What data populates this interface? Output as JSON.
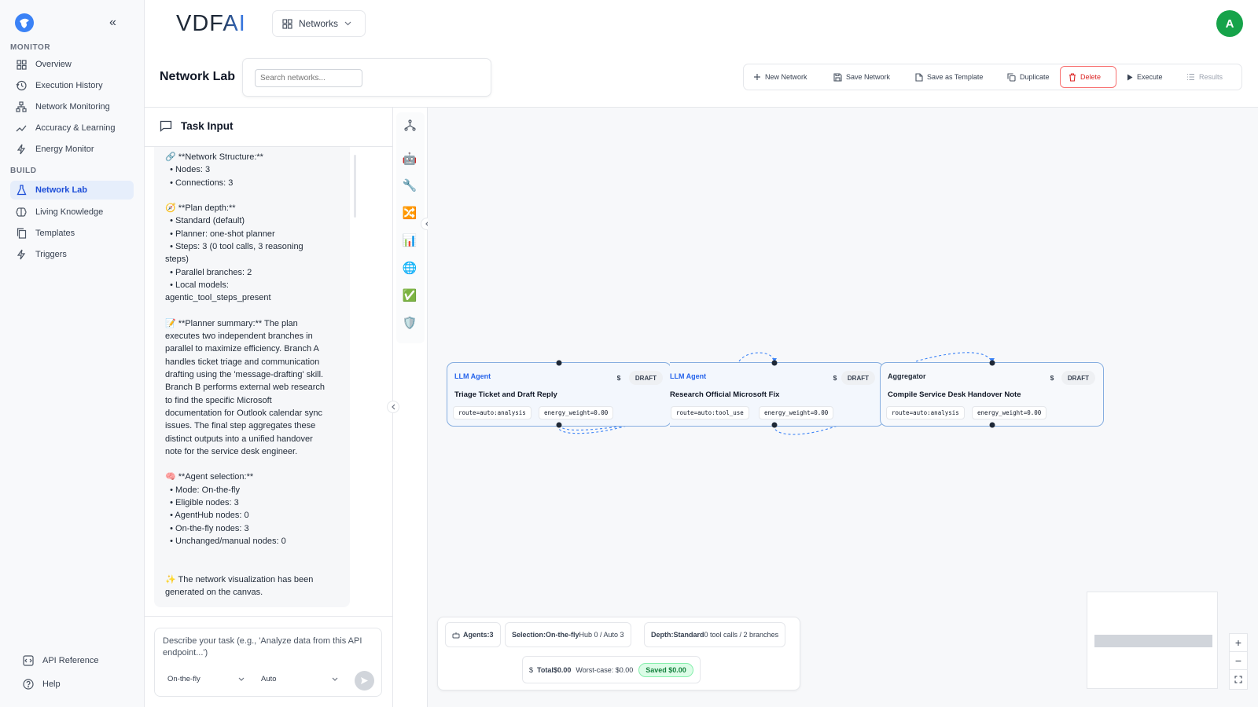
{
  "brand": {
    "logo_text": "VDFAI"
  },
  "sidebar": {
    "sections": {
      "monitor": "MONITOR",
      "build": "BUILD"
    },
    "monitor_items": [
      {
        "label": "Overview",
        "icon": "grid-icon"
      },
      {
        "label": "Execution History",
        "icon": "history-icon"
      },
      {
        "label": "Network Monitoring",
        "icon": "network-icon"
      },
      {
        "label": "Accuracy & Learning",
        "icon": "trend-icon"
      },
      {
        "label": "Energy Monitor",
        "icon": "bolt-icon"
      }
    ],
    "build_items": [
      {
        "label": "Network Lab",
        "icon": "flask-icon",
        "active": true
      },
      {
        "label": "Living Knowledge",
        "icon": "brain-icon"
      },
      {
        "label": "Templates",
        "icon": "copy-icon"
      },
      {
        "label": "Triggers",
        "icon": "bolt-icon"
      }
    ],
    "footer": {
      "api_reference": "API Reference",
      "help": "Help"
    }
  },
  "header": {
    "networks_dropdown": "Networks",
    "avatar_initial": "A",
    "accent": "#16a34a"
  },
  "lab": {
    "title": "Network Lab",
    "search_placeholder": "Search networks...",
    "toolbar": {
      "new_network": "New Network",
      "save_network": "Save Network",
      "save_template": "Save as Template",
      "duplicate": "Duplicate",
      "delete": "Delete",
      "execute": "Execute",
      "results": "Results"
    }
  },
  "task_panel": {
    "title": "Task Input",
    "message_lines": [
      "🔗 **Network Structure:**",
      "  • Nodes: 3",
      "  • Connections: 3",
      "",
      "🧭 **Plan depth:**",
      "  • Standard (default)",
      "  • Planner: one-shot planner",
      "  • Steps: 3 (0 tool calls, 3 reasoning",
      "steps)",
      "  • Parallel branches: 2",
      "  • Local models:",
      "agentic_tool_steps_present",
      "",
      "📝 **Planner summary:** The plan",
      "executes two independent branches in",
      "parallel to maximize efficiency. Branch A",
      "handles ticket triage and communication",
      "drafting using the 'message-drafting' skill.",
      "Branch B performs external web research",
      "to find the specific Microsoft",
      "documentation for Outlook calendar sync",
      "issues. The final step aggregates these",
      "distinct outputs into a unified handover",
      "note for the service desk engineer.",
      "",
      "🧠 **Agent selection:**",
      "  • Mode: On-the-fly",
      "  • Eligible nodes: 3",
      "  • AgentHub nodes: 0",
      "  • On-the-fly nodes: 3",
      "  • Unchanged/manual nodes: 0",
      "",
      "",
      "✨ The network visualization has been",
      "generated on the canvas."
    ],
    "input_placeholder": "Describe your task (e.g., 'Analyze data from this API endpoint...')",
    "mode_select": "On-the-fly",
    "model_select": "Auto"
  },
  "palette": {
    "tools": [
      {
        "name": "robot-icon",
        "glyph": "🤖"
      },
      {
        "name": "wrench-icon",
        "glyph": "🔧"
      },
      {
        "name": "shuffle-icon",
        "glyph": "🔀"
      },
      {
        "name": "bar-chart-icon",
        "glyph": "📊"
      },
      {
        "name": "globe-icon",
        "glyph": "🌐"
      },
      {
        "name": "check-icon",
        "glyph": "✅"
      },
      {
        "name": "shield-icon",
        "glyph": "🛡️"
      }
    ]
  },
  "nodes": [
    {
      "type": "LLM Agent",
      "title": "Triage Ticket and Draft Reply",
      "cost": "$",
      "status": "DRAFT",
      "route": "route=auto:analysis",
      "energy": "energy_weight=0.00"
    },
    {
      "type": "LLM Agent",
      "title": "Research Official Microsoft Fix",
      "cost": "$",
      "status": "DRAFT",
      "route": "route=auto:tool_use",
      "energy": "energy_weight=0.00"
    },
    {
      "type": "Aggregator",
      "title": "Compile Service Desk Handover Note",
      "cost": "$",
      "status": "DRAFT",
      "route": "route=auto:analysis",
      "energy": "energy_weight=0.00"
    }
  ],
  "stats": {
    "agents_label": "Agents:",
    "agents_value": "3",
    "selection_label": "Selection:",
    "selection_value": "On-the-fly",
    "selection_rest": "Hub 0 / Auto 3",
    "depth_label": "Depth:",
    "depth_value": "Standard",
    "depth_rest": "0 tool calls / 2 branches",
    "total_label": "Total",
    "total_value": "$0.00",
    "worst_case": "Worst-case: $0.00",
    "saved": "Saved $0.00"
  },
  "zoom": {
    "in": "+",
    "out": "−"
  }
}
